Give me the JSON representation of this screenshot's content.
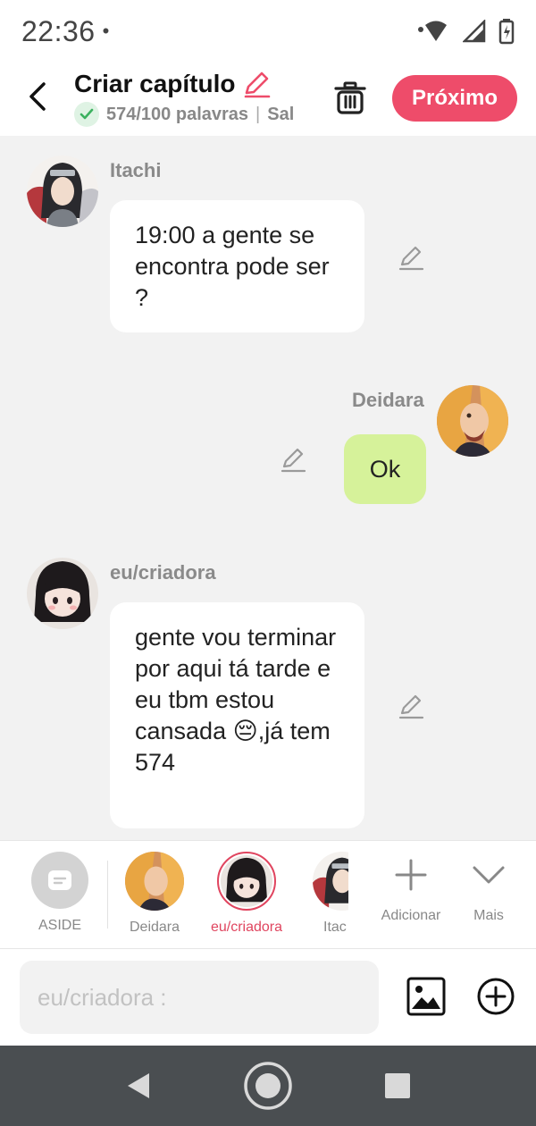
{
  "status_bar": {
    "time": "22:36",
    "dot": "•"
  },
  "header": {
    "title": "Criar capítulo",
    "word_count": "574/100 palavras",
    "separator": "|",
    "truncated_text": "Sal",
    "next_label": "Próximo"
  },
  "messages": [
    {
      "sender": "Itachi",
      "text": "19:00 a gente se encontra pode ser ?",
      "side": "left"
    },
    {
      "sender": "Deidara",
      "text": "Ok",
      "side": "right"
    },
    {
      "sender": "eu/criadora",
      "text": "gente vou terminar por aqui tá tarde e eu tbm estou cansada 😔,já tem 574",
      "side": "left"
    }
  ],
  "characters": {
    "aside_label": "ASIDE",
    "items": [
      {
        "label": "Deidara"
      },
      {
        "label": "eu/criadora",
        "selected": true
      },
      {
        "label": "Itac"
      }
    ],
    "add_label": "Adicionar",
    "more_label": "Mais"
  },
  "input": {
    "placeholder": "eu/criadora :"
  },
  "colors": {
    "accent": "#ee4c6a",
    "selected_name": "#e0455f",
    "mine_bubble": "#d6f29a",
    "check_green": "#3bb15f"
  }
}
